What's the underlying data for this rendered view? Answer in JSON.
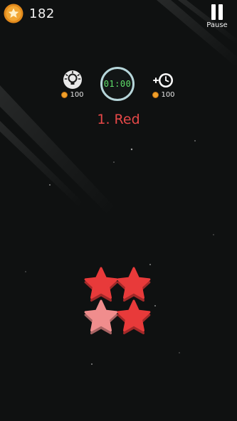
{
  "hud": {
    "coins": "182",
    "pause_label": "Pause"
  },
  "powerups": {
    "hint": {
      "icon": "lightbulb-icon",
      "cost": "100"
    },
    "add_time": {
      "icon": "add-time-clock-icon",
      "cost": "100"
    }
  },
  "timer": {
    "display": "01:00"
  },
  "round": {
    "label": "1. Red"
  },
  "pieces": [
    {
      "shape": "star",
      "color": "#e83a3a"
    },
    {
      "shape": "star",
      "color": "#e83a3a"
    },
    {
      "shape": "star",
      "color": "#f08d8d"
    },
    {
      "shape": "star",
      "color": "#e83a3a"
    }
  ],
  "colors": {
    "accent_red": "#e64848",
    "coin_gold": "#f0a02a",
    "timer_green": "#5fe06a"
  }
}
